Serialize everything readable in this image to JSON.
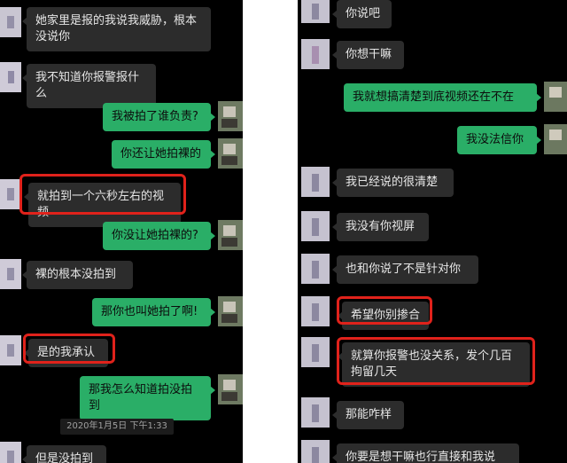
{
  "left_chat": {
    "messages": [
      {
        "side": "in",
        "text": "她家里是报的我说我威胁，根本没说你",
        "highlighted": false
      },
      {
        "side": "in",
        "text": "我不知道你报警报什么",
        "highlighted": false
      },
      {
        "side": "out",
        "text": "我被拍了谁负责?",
        "highlighted": false
      },
      {
        "side": "out",
        "text": "你还让她拍裸的",
        "highlighted": false
      },
      {
        "side": "in",
        "text": "就拍到一个六秒左右的视频",
        "highlighted": true
      },
      {
        "side": "out",
        "text": "你没让她拍裸的?",
        "highlighted": false
      },
      {
        "side": "in",
        "text": "裸的根本没拍到",
        "highlighted": false
      },
      {
        "side": "out",
        "text": "那你也叫她拍了啊!",
        "highlighted": false
      },
      {
        "side": "in",
        "text": "是的我承认",
        "highlighted": true
      },
      {
        "side": "out",
        "text": "那我怎么知道拍没拍到",
        "highlighted": false
      },
      {
        "side": "in",
        "text": "但是没拍到",
        "highlighted": false
      }
    ],
    "timestamp": "2020年1月5日 下午1:33"
  },
  "right_chat": {
    "messages": [
      {
        "side": "in",
        "text": "你说吧",
        "highlighted": false
      },
      {
        "side": "in",
        "text": "你想干嘛",
        "highlighted": false
      },
      {
        "side": "out",
        "text": "我就想搞清楚到底视频还在不在",
        "highlighted": false
      },
      {
        "side": "out",
        "text": "我没法信你",
        "highlighted": false
      },
      {
        "side": "in",
        "text": "我已经说的很清楚",
        "highlighted": false
      },
      {
        "side": "in",
        "text": "我没有你视屏",
        "highlighted": false
      },
      {
        "side": "in",
        "text": "也和你说了不是针对你",
        "highlighted": false
      },
      {
        "side": "in",
        "text": "希望你别掺合",
        "highlighted": true
      },
      {
        "side": "in",
        "text": "就算你报警也没关系，发个几百拘留几天",
        "highlighted": true
      },
      {
        "side": "in",
        "text": "那能咋样",
        "highlighted": false
      },
      {
        "side": "in",
        "text": "你要是想干嘛也行直接和我说",
        "highlighted": false
      }
    ]
  },
  "colors": {
    "background": "#000000",
    "incoming_bubble": "#2c2c2c",
    "outgoing_bubble": "#2aae67",
    "highlight_box": "#e0221b",
    "divider": "#ffffff"
  }
}
